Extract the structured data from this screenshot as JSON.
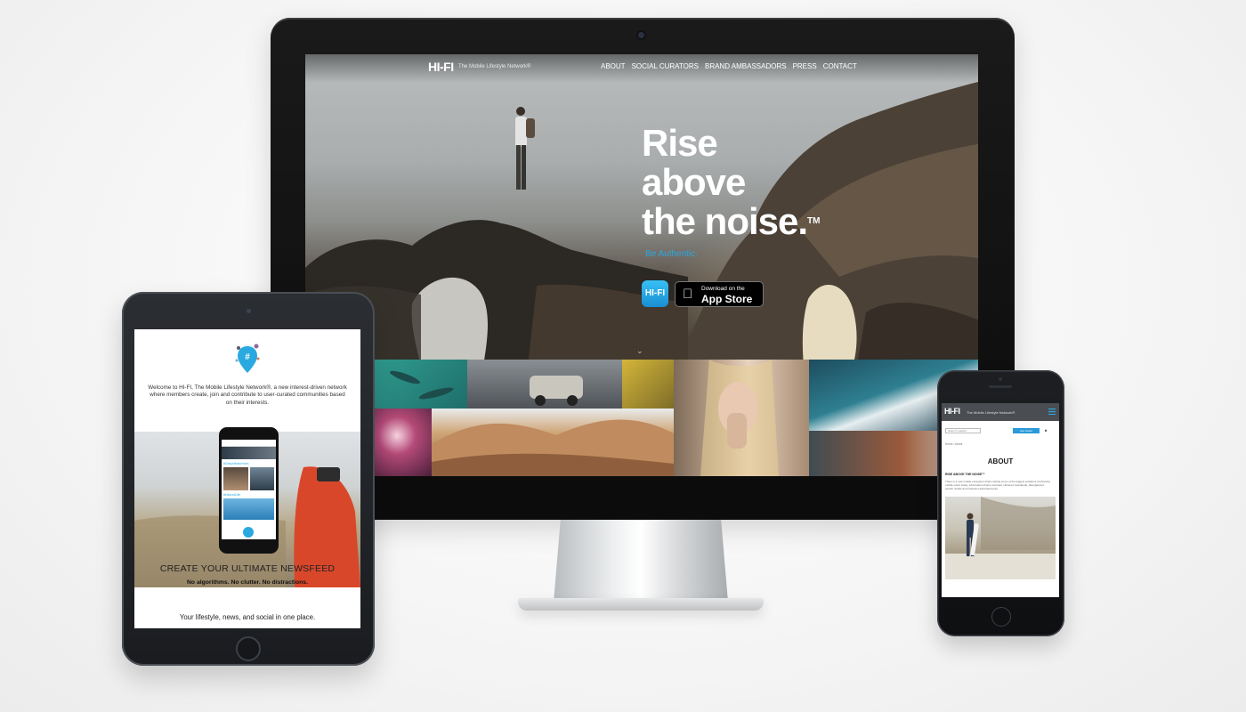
{
  "desktop": {
    "logo_text": "HI-FI",
    "logo_tagline": "The Mobile Lifestyle Network®",
    "nav": [
      "ABOUT",
      "SOCIAL CURATORS",
      "BRAND AMBASSADORS",
      "PRESS",
      "CONTACT"
    ],
    "headline": [
      "Rise",
      "above",
      "the noise."
    ],
    "headline_tm": "TM",
    "tagline": "Be Authentic.",
    "app_icon_text": "HI-FI",
    "appstore": {
      "small": "Download on the",
      "big": "App Store"
    },
    "accent_color": "#2aa8e0"
  },
  "tablet": {
    "welcome": "Welcome to HI-FI, The Mobile Lifestyle Network®, a new interest-driven network where members create, join and contribute to user-curated communities based on their interests.",
    "phone_tag_1": "#DelphNewYork",
    "phone_tag_2": "#IslandLife",
    "create_heading": "CREATE YOUR ULTIMATE NEWSFEED",
    "no_algorithms": "No algorithms. No clutter. No distractions.",
    "lifestyle": "Your lifestyle, news, and social in one place."
  },
  "phone": {
    "logo_text": "HI-FI",
    "logo_tagline": "The Mobile Lifestyle Network®",
    "search_placeholder": "Search Leaderb",
    "button_label": "Get Listed",
    "crumb": "Home / About",
    "about_heading": "ABOUT",
    "rise_label": "RISE ABOVE THE NOISE™",
    "body": "There is a new mobile ecosystem that's raising some of the biggest problems confronting mobile users today: information-choice overload, cluttered newsfeeds, disorganized search results and irrelevant advertisements."
  }
}
